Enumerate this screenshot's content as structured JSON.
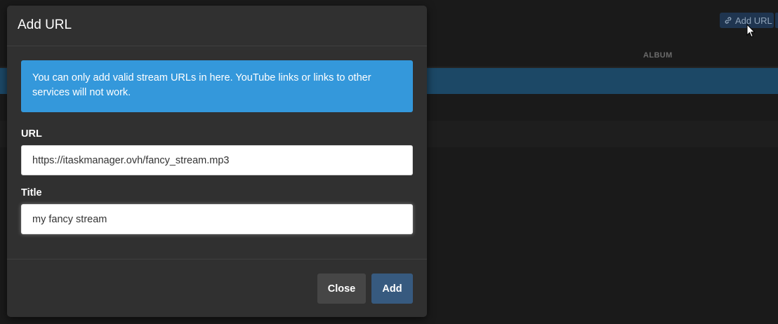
{
  "background": {
    "add_url_button": {
      "label": "Add URL",
      "icon": "link-icon"
    },
    "table": {
      "columns": [
        "ALBUM"
      ]
    },
    "cursor_icon": "mouse-pointer-icon"
  },
  "modal": {
    "title": "Add URL",
    "alert": "You can only add valid stream URLs in here. YouTube links or links to other services will not work.",
    "url_field": {
      "label": "URL",
      "value": "https://itaskmanager.ovh/fancy_stream.mp3"
    },
    "title_field": {
      "label": "Title",
      "value": "my fancy stream"
    },
    "buttons": {
      "close": "Close",
      "add": "Add"
    }
  },
  "colors": {
    "alert_info": "#3498db",
    "primary_button": "#375a7f",
    "secondary_button": "#464646",
    "modal_background": "#303030",
    "selected_row": "#1c4866"
  }
}
